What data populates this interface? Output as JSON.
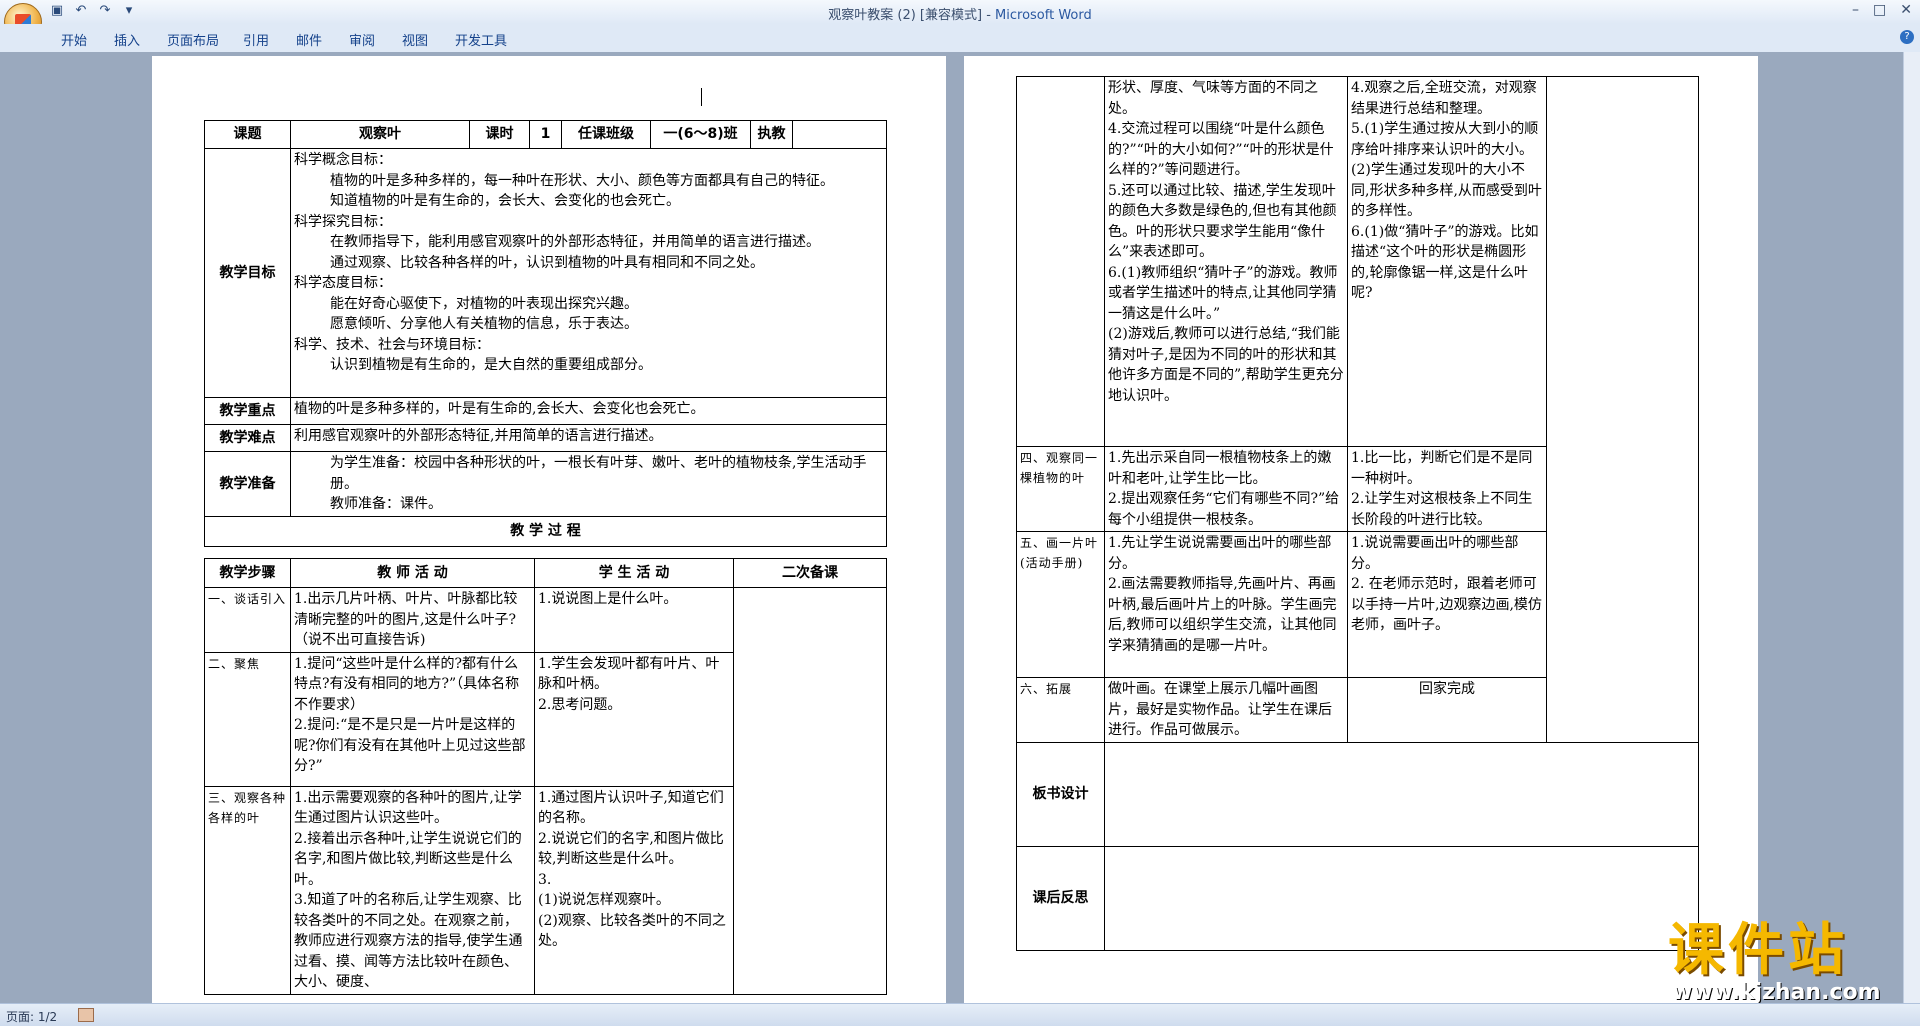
{
  "window": {
    "title": "观察叶教案 (2) [兼容模式] - ",
    "app_name": "Microsoft Word",
    "help": "?"
  },
  "quick_access": {
    "save_icon": "save-icon",
    "undo_icon": "undo-icon",
    "redo_icon": "redo-icon"
  },
  "ribbon": {
    "tabs": [
      "开始",
      "插入",
      "页面布局",
      "引用",
      "邮件",
      "审阅",
      "视图",
      "开发工具"
    ]
  },
  "status": {
    "page": "页面: 1/2"
  },
  "watermark": {
    "name": "课件站",
    "url": "www.kjzhan.com"
  },
  "lesson": {
    "topic_label": "课题",
    "topic": "观察叶",
    "hours_label": "课时",
    "hours": "1",
    "class_label": "任课班级",
    "class": "一(6～8)班",
    "teacher_label": "执教",
    "goals_label": "教学目标",
    "goals": [
      "科学概念目标：",
      "植物的叶是多种多样的，每一种叶在形状、大小、颜色等方面都具有自己的特征。",
      "知道植物的叶是有生命的，会长大、会变化的也会死亡。",
      "科学探究目标：",
      "在教师指导下，能利用感官观察叶的外部形态特征，并用简单的语言进行描述。",
      "通过观察、比较各种各样的叶，认识到植物的叶具有相同和不同之处。",
      "科学态度目标：",
      "能在好奇心驱使下，对植物的叶表现出探究兴趣。",
      "愿意倾听、分享他人有关植物的信息，乐于表达。",
      "科学、技术、社会与环境目标：",
      "认识到植物是有生命的，是大自然的重要组成部分。"
    ],
    "key_label": "教学重点",
    "key": "植物的叶是多种多样的，叶是有生命的,会长大、会变化也会死亡。",
    "difficulty_label": "教学难点",
    "difficulty": "利用感官观察叶的外部形态特征,并用简单的语言进行描述。",
    "prep_label": "教学准备",
    "prep": [
      "为学生准备：校园中各种形状的叶，一根长有叶芽、嫩叶、老叶的植物枝条,学生活动手册。",
      "教师准备：课件。"
    ],
    "process_title": "教 学 过 程",
    "col_step": "教学步骤",
    "col_teacher": "教 师 活 动",
    "col_student": "学 生 活 动",
    "col_revision": "二次备课",
    "steps": [
      {
        "step": "一、谈话引入",
        "teacher": "1.出示几片叶柄、叶片、叶脉都比较清晰完整的叶的图片,这是什么叶子?（说不出可直接告诉)",
        "student": "1.说说图上是什么叶。"
      },
      {
        "step": "二、聚焦",
        "teacher": "1.提问“这些叶是什么样的?都有什么特点?有没有相同的地方?”（具体名称不作要求）\n2.提问:“是不是只是一片叶是这样的呢?你们有没有在其他叶上见过这些部分?”",
        "student": "1.学生会发现叶都有叶片、叶脉和叶柄。\n2.思考问题。"
      },
      {
        "step": "三、观察各种各样的叶",
        "teacher": "1.出示需要观察的各种叶的图片,让学生通过图片认识这些叶。\n2.接着出示各种叶,让学生说说它们的名字,和图片做比较,判断这些是什么叶。\n3.知道了叶的名称后,让学生观察、比较各类叶的不同之处。在观察之前，教师应进行观察方法的指导,使学生通过看、摸、闻等方法比较叶在颜色、大小、硬度、",
        "student": "1.通过图片认识叶子,知道它们的名称。\n2.说说它们的名字,和图片做比较,判断这些是什么叶。\n3.\n(1)说说怎样观察叶。\n(2)观察、比较各类叶的不同之处。"
      }
    ],
    "steps2": [
      {
        "step": "",
        "teacher": "形状、厚度、气味等方面的不同之处。\n4.交流过程可以围绕“叶是什么颜色的?”“叶的大小如何?”“叶的形状是什么样的?”等问题进行。\n5.还可以通过比较、描述,学生发现叶的颜色大多数是绿色的,但也有其他颜色。叶的形状只要求学生能用“像什么”来表述即可。\n6.(1)教师组织“猜叶子”的游戏。教师或者学生描述叶的特点,让其他同学猜一猜这是什么叶。”\n(2)游戏后,教师可以进行总结,“我们能猜对叶子,是因为不同的叶的形状和其他许多方面是不同的”,帮助学生更充分地认识叶。",
        "student": "4.观察之后,全班交流，对观察结果进行总结和整理。\n5.(1)学生通过按从大到小的顺序给叶排序来认识叶的大小。\n(2)学生通过发现叶的大小不同,形状多种多样,从而感受到叶的多样性。\n6.(1)做“猜叶子”的游戏。比如描述“这个叶的形状是椭圆形的,轮廓像锯一样,这是什么叶呢?"
      },
      {
        "step": "四、观察同一棵植物的叶",
        "teacher": "1.先出示采自同一根植物枝条上的嫩叶和老叶,让学生比一比。\n2.提出观察任务“它们有哪些不同?”给每个小组提供一根枝条。",
        "student": "1.比一比，判断它们是不是同一种树叶。\n2.让学生对这根枝条上不同生长阶段的叶进行比较。"
      },
      {
        "step": "五、画一片叶(活动手册)",
        "teacher": "1.先让学生说说需要画出叶的哪些部分。\n2.画法需要教师指导,先画叶片、再画叶柄,最后画叶片上的叶脉。学生画完后,教师可以组织学生交流，让其他同学来猜猜画的是哪一片叶。",
        "student": "1.说说需要画出叶的哪些部分。\n2. 在老师示范时，跟着老师可以手持一片叶,边观察边画,模仿老师，画叶子。"
      },
      {
        "step": "六、拓展",
        "teacher": "做叶画。在课堂上展示几幅叶画图片，最好是实物作品。让学生在课后进行。作品可做展示。",
        "student": "回家完成"
      }
    ],
    "board_label": "板书设计",
    "reflection_label": "课后反思"
  }
}
